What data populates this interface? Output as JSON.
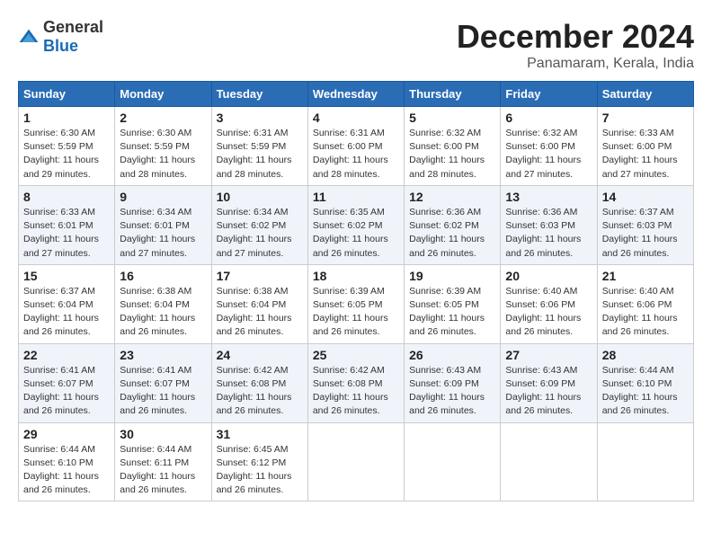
{
  "logo": {
    "text_general": "General",
    "text_blue": "Blue"
  },
  "title": "December 2024",
  "subtitle": "Panamaram, Kerala, India",
  "days_of_week": [
    "Sunday",
    "Monday",
    "Tuesday",
    "Wednesday",
    "Thursday",
    "Friday",
    "Saturday"
  ],
  "weeks": [
    [
      {
        "day": "1",
        "sunrise": "6:30 AM",
        "sunset": "5:59 PM",
        "daylight": "11 hours and 29 minutes."
      },
      {
        "day": "2",
        "sunrise": "6:30 AM",
        "sunset": "5:59 PM",
        "daylight": "11 hours and 28 minutes."
      },
      {
        "day": "3",
        "sunrise": "6:31 AM",
        "sunset": "5:59 PM",
        "daylight": "11 hours and 28 minutes."
      },
      {
        "day": "4",
        "sunrise": "6:31 AM",
        "sunset": "6:00 PM",
        "daylight": "11 hours and 28 minutes."
      },
      {
        "day": "5",
        "sunrise": "6:32 AM",
        "sunset": "6:00 PM",
        "daylight": "11 hours and 28 minutes."
      },
      {
        "day": "6",
        "sunrise": "6:32 AM",
        "sunset": "6:00 PM",
        "daylight": "11 hours and 27 minutes."
      },
      {
        "day": "7",
        "sunrise": "6:33 AM",
        "sunset": "6:00 PM",
        "daylight": "11 hours and 27 minutes."
      }
    ],
    [
      {
        "day": "8",
        "sunrise": "6:33 AM",
        "sunset": "6:01 PM",
        "daylight": "11 hours and 27 minutes."
      },
      {
        "day": "9",
        "sunrise": "6:34 AM",
        "sunset": "6:01 PM",
        "daylight": "11 hours and 27 minutes."
      },
      {
        "day": "10",
        "sunrise": "6:34 AM",
        "sunset": "6:02 PM",
        "daylight": "11 hours and 27 minutes."
      },
      {
        "day": "11",
        "sunrise": "6:35 AM",
        "sunset": "6:02 PM",
        "daylight": "11 hours and 26 minutes."
      },
      {
        "day": "12",
        "sunrise": "6:36 AM",
        "sunset": "6:02 PM",
        "daylight": "11 hours and 26 minutes."
      },
      {
        "day": "13",
        "sunrise": "6:36 AM",
        "sunset": "6:03 PM",
        "daylight": "11 hours and 26 minutes."
      },
      {
        "day": "14",
        "sunrise": "6:37 AM",
        "sunset": "6:03 PM",
        "daylight": "11 hours and 26 minutes."
      }
    ],
    [
      {
        "day": "15",
        "sunrise": "6:37 AM",
        "sunset": "6:04 PM",
        "daylight": "11 hours and 26 minutes."
      },
      {
        "day": "16",
        "sunrise": "6:38 AM",
        "sunset": "6:04 PM",
        "daylight": "11 hours and 26 minutes."
      },
      {
        "day": "17",
        "sunrise": "6:38 AM",
        "sunset": "6:04 PM",
        "daylight": "11 hours and 26 minutes."
      },
      {
        "day": "18",
        "sunrise": "6:39 AM",
        "sunset": "6:05 PM",
        "daylight": "11 hours and 26 minutes."
      },
      {
        "day": "19",
        "sunrise": "6:39 AM",
        "sunset": "6:05 PM",
        "daylight": "11 hours and 26 minutes."
      },
      {
        "day": "20",
        "sunrise": "6:40 AM",
        "sunset": "6:06 PM",
        "daylight": "11 hours and 26 minutes."
      },
      {
        "day": "21",
        "sunrise": "6:40 AM",
        "sunset": "6:06 PM",
        "daylight": "11 hours and 26 minutes."
      }
    ],
    [
      {
        "day": "22",
        "sunrise": "6:41 AM",
        "sunset": "6:07 PM",
        "daylight": "11 hours and 26 minutes."
      },
      {
        "day": "23",
        "sunrise": "6:41 AM",
        "sunset": "6:07 PM",
        "daylight": "11 hours and 26 minutes."
      },
      {
        "day": "24",
        "sunrise": "6:42 AM",
        "sunset": "6:08 PM",
        "daylight": "11 hours and 26 minutes."
      },
      {
        "day": "25",
        "sunrise": "6:42 AM",
        "sunset": "6:08 PM",
        "daylight": "11 hours and 26 minutes."
      },
      {
        "day": "26",
        "sunrise": "6:43 AM",
        "sunset": "6:09 PM",
        "daylight": "11 hours and 26 minutes."
      },
      {
        "day": "27",
        "sunrise": "6:43 AM",
        "sunset": "6:09 PM",
        "daylight": "11 hours and 26 minutes."
      },
      {
        "day": "28",
        "sunrise": "6:44 AM",
        "sunset": "6:10 PM",
        "daylight": "11 hours and 26 minutes."
      }
    ],
    [
      {
        "day": "29",
        "sunrise": "6:44 AM",
        "sunset": "6:10 PM",
        "daylight": "11 hours and 26 minutes."
      },
      {
        "day": "30",
        "sunrise": "6:44 AM",
        "sunset": "6:11 PM",
        "daylight": "11 hours and 26 minutes."
      },
      {
        "day": "31",
        "sunrise": "6:45 AM",
        "sunset": "6:12 PM",
        "daylight": "11 hours and 26 minutes."
      },
      null,
      null,
      null,
      null
    ]
  ]
}
